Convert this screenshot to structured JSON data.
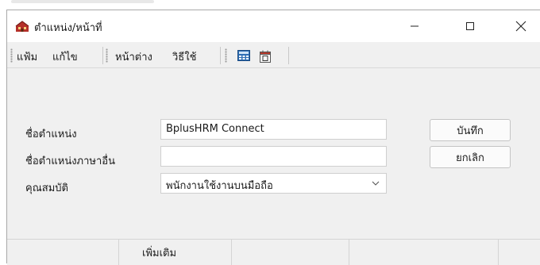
{
  "window": {
    "title": "ตำแหน่ง/หน้าที่",
    "icon": "app-building-icon",
    "controls": [
      "minimize-icon",
      "maximize-icon",
      "close-icon"
    ]
  },
  "menubar": {
    "items": [
      {
        "label": "แฟ้ม"
      },
      {
        "label": "แก้ไข"
      },
      {
        "label": "หน้าต่าง"
      },
      {
        "label": "วิธีใช้"
      }
    ],
    "toolbar_icons": [
      "calculator-icon",
      "calendar-icon"
    ]
  },
  "form": {
    "fields": [
      {
        "label": "ชื่อตำแหน่ง",
        "value": "BplusHRM Connect"
      },
      {
        "label": "ชื่อตำแหน่งภาษาอื่น",
        "value": ""
      },
      {
        "label": "คุณสมบัติ",
        "value": "พนักงานใช้งานบนมือถือ"
      }
    ],
    "save_label": "บันทึก",
    "cancel_label": "ยกเลิก"
  },
  "bottom_tabs": {
    "label": "เพิ่มเติม"
  }
}
